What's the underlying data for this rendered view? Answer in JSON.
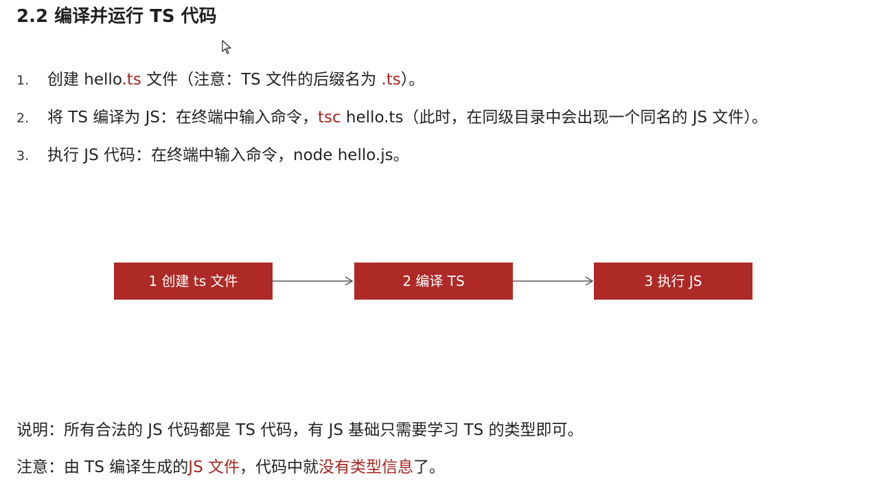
{
  "heading": "2.2 编译并运行 TS 代码",
  "steps": [
    {
      "num": "1.",
      "a": "创建 hello",
      "a_red": ".ts",
      "b": " 文件（注意：TS 文件的后缀名为 ",
      "b_red": ".ts",
      "c": "）。"
    },
    {
      "num": "2.",
      "a": "将 TS 编译为 JS：在终端中输入命令，",
      "a_red": "tsc",
      "b": " hello.ts（此时，在同级目录中会出现一个同名的 JS 文件）。"
    },
    {
      "num": "3.",
      "a": "执行 JS 代码：在终端中输入命令，node hello.js。"
    }
  ],
  "flow": {
    "boxes": [
      "1 创建 ts 文件",
      "2 编译 TS",
      "3 执行 JS"
    ],
    "box_color": "#ad2a26",
    "arrow_color": "#555555"
  },
  "notes": [
    {
      "a": "说明：所有合法的 JS 代码都是 TS 代码，有 JS 基础只需要学习 TS 的类型即可。"
    },
    {
      "a": "注意：由 TS 编译生成的",
      "a_red": "JS 文件",
      "b": "，代码中就",
      "b_red": "没有类型信息",
      "c": "了。"
    }
  ],
  "colors": {
    "accent_red": "#a82520",
    "text": "#222222"
  },
  "icons": {
    "cursor": "mouse-pointer-icon"
  }
}
